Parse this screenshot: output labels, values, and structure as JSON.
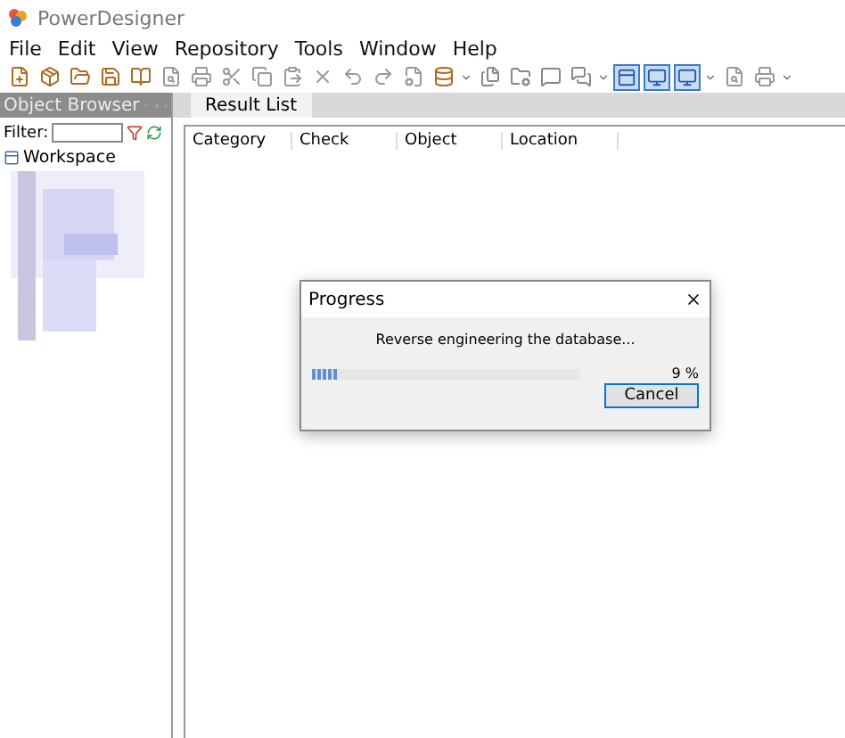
{
  "window": {
    "title": "PowerDesigner"
  },
  "menu": [
    "File",
    "Edit",
    "View",
    "Repository",
    "Tools",
    "Window",
    "Help"
  ],
  "toolbar_toggles": [
    {
      "selected": true
    },
    {
      "selected": true
    },
    {
      "selected": true
    }
  ],
  "object_browser": {
    "title": "Object Browser",
    "filter_label": "Filter:",
    "tree": [
      {
        "label": "Workspace"
      }
    ]
  },
  "tabs": [
    {
      "label": "Result List",
      "selected": true
    }
  ],
  "table": {
    "columns": [
      "Category",
      "Check",
      "Object",
      "Location"
    ]
  },
  "dialog": {
    "title": "Progress",
    "message": "Reverse engineering the database...",
    "level": 0.09,
    "reading": "9 %",
    "buttons": [
      "Cancel"
    ]
  }
}
